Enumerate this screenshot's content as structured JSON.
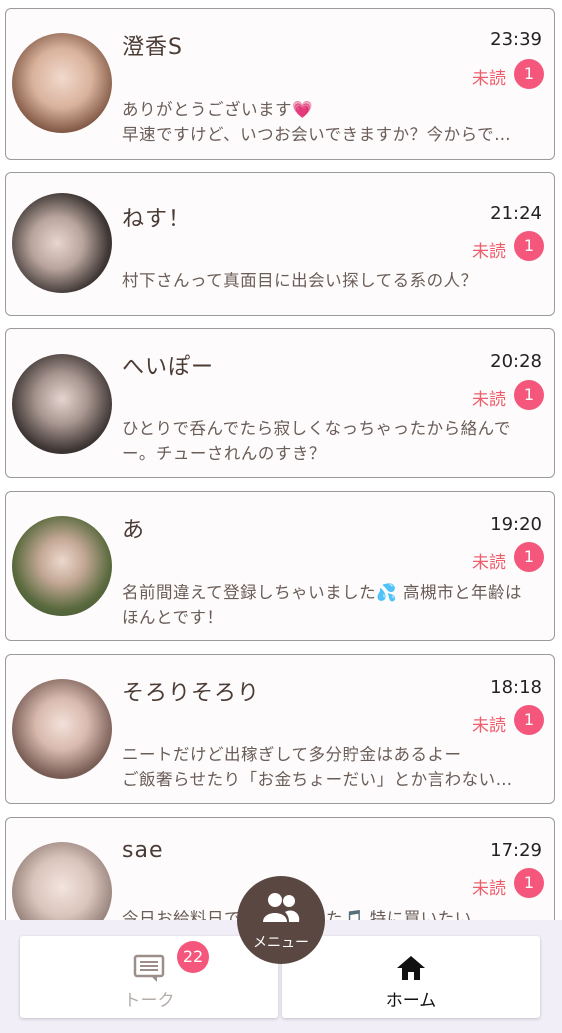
{
  "conversations": [
    {
      "name": "澄香S",
      "time": "23:39",
      "unread_label": "未読",
      "unread_count": "1",
      "message_line1": "ありがとうございます💗",
      "message_line2": "早速ですけど、いつお会いできますか？今からで…",
      "avatar_color": "#c7a08a"
    },
    {
      "name": "ねす！",
      "time": "21:24",
      "unread_label": "未読",
      "unread_count": "1",
      "message_line1": "村下さんって真面目に出会い探してる系の人？",
      "message_line2": "",
      "avatar_color": "#8c7c78"
    },
    {
      "name": "へいぽー",
      "time": "20:28",
      "unread_label": "未読",
      "unread_count": "1",
      "message_line1": "ひとりで呑んでたら寂しくなっちゃったから絡んで",
      "message_line2": "ー。チューされんのすき？",
      "avatar_color": "#5c5450"
    },
    {
      "name": "あ",
      "time": "19:20",
      "unread_label": "未読",
      "unread_count": "1",
      "message_line1": "名前間違えて登録しちゃいました💦 高槻市と年齢は",
      "message_line2": "ほんとです！",
      "avatar_color": "#6c7a52"
    },
    {
      "name": "そろりそろり",
      "time": "18:18",
      "unread_label": "未読",
      "unread_count": "1",
      "message_line1": "ニートだけど出稼ぎして多分貯金はあるよー",
      "message_line2": "ご飯奢らせたり「お金ちょーだい」とか言わない…",
      "avatar_color": "#b79a90"
    },
    {
      "name": "sae",
      "time": "17:29",
      "unread_label": "未読",
      "unread_count": "1",
      "message_line1": "今日お給料日で…が出ました🎵 特に買いたい",
      "message_line2": "",
      "avatar_color": "#c9b7ae"
    }
  ],
  "bottom_nav": {
    "talk_label": "トーク",
    "talk_badge": "22",
    "home_label": "ホーム",
    "menu_label": "メニュー"
  },
  "colors": {
    "accent": "#f5577c",
    "unread_text": "#ee5d6c",
    "menu_bg": "#5b4741"
  }
}
